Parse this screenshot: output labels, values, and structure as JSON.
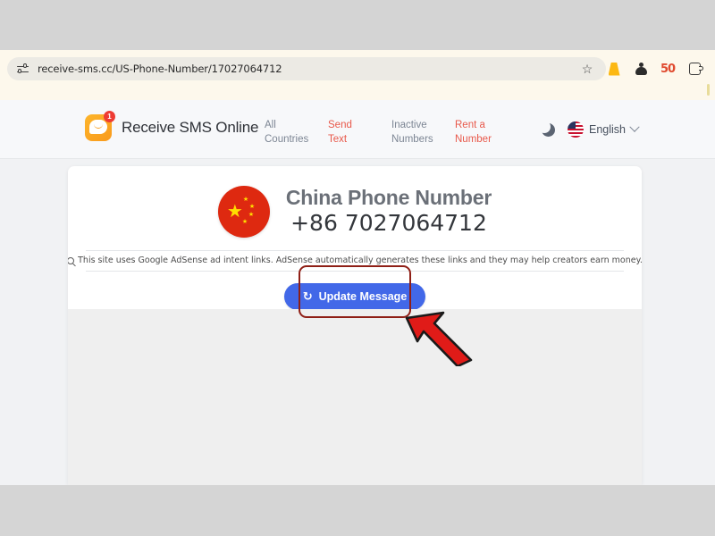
{
  "browser": {
    "url": "receive-sms.cc/US-Phone-Number/17027064712",
    "site_settings_icon": "tune-sliders-icon",
    "bookmark_icon": "star-icon",
    "notification_icon": "bell-icon",
    "extension_icon": "extension-icon",
    "money_icon": "cash-50-icon",
    "puzzle_icon": "puzzle-piece-icon"
  },
  "site_header": {
    "brand_name": "Receive SMS Online",
    "brand_badge": "1",
    "logo_icon": "chat-bubble-smiley-icon",
    "nav": [
      {
        "line1": "All",
        "line2": "Countries",
        "accent": false
      },
      {
        "line1": "Send",
        "line2": "Text",
        "accent": true
      },
      {
        "line1": "Inactive",
        "line2": "Numbers",
        "accent": false
      },
      {
        "line1": "Rent a",
        "line2": "Number",
        "accent": true
      }
    ],
    "dark_mode_icon": "moon-icon",
    "language": {
      "flag": "us-flag-icon",
      "label": "English",
      "chevron": "chevron-down-icon"
    }
  },
  "main": {
    "country_flag": "china-flag-icon",
    "title": "China Phone Number",
    "phone_number": "+86 7027064712",
    "adsense_notice": "This site uses Google AdSense ad intent links. AdSense automatically generates these links and they may help creators earn money.",
    "adsense_icon": "magnifier-icon",
    "update_button": {
      "label": "Update Message",
      "icon": "refresh-icon",
      "color": "#4268e8"
    }
  },
  "annotations": {
    "highlight_box_color": "#8f1f16",
    "arrow_color": "#e01b18",
    "arrow_target": "update-message-button"
  }
}
